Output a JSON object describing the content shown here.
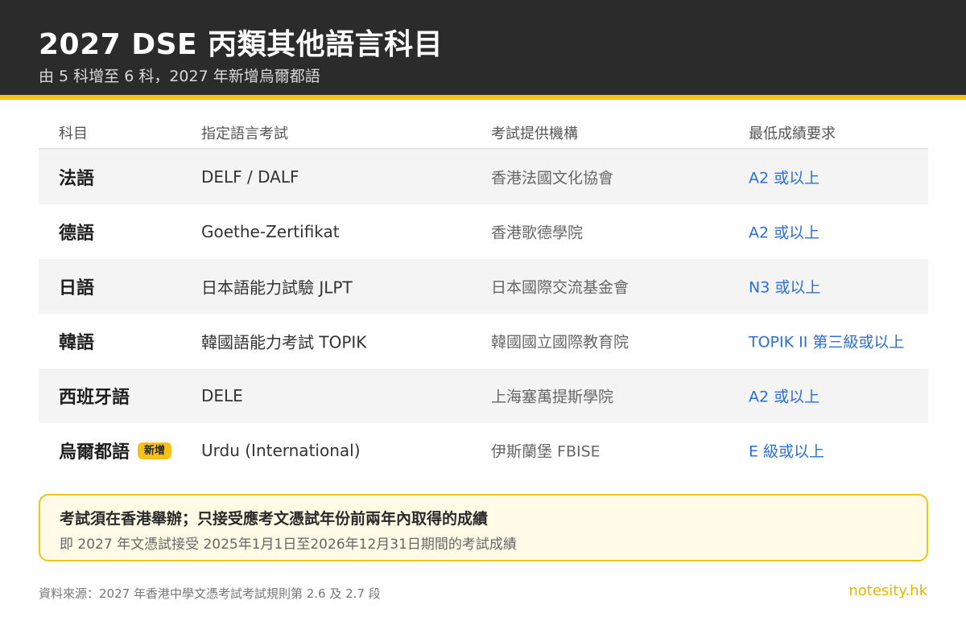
{
  "colors": {
    "header_bg": "#2b2b2b",
    "accent": "#f5c218",
    "requirement_link": "#2b6fd6",
    "note_bg": "#fffbe6",
    "note_border": "#f0c419",
    "brand": "#e8b500"
  },
  "header": {
    "title": "2027 DSE 丙類其他語言科目",
    "subtitle": "由 5 科增至 6 科，2027 年新增烏爾都語"
  },
  "table": {
    "columns": [
      "科目",
      "指定語言考試",
      "考試提供機構",
      "最低成績要求"
    ],
    "rows": [
      {
        "subject": "法語",
        "exam": "DELF / DALF",
        "provider": "香港法國文化協會",
        "requirement": "A2 或以上"
      },
      {
        "subject": "德語",
        "exam": "Goethe-Zertifikat",
        "provider": "香港歌德學院",
        "requirement": "A2 或以上"
      },
      {
        "subject": "日語",
        "exam": "日本語能力試驗 JLPT",
        "provider": "日本國際交流基金會",
        "requirement": "N3 或以上"
      },
      {
        "subject": "韓語",
        "exam": "韓國語能力考試 TOPIK",
        "provider": "韓國國立國際教育院",
        "requirement": "TOPIK II 第三級或以上"
      },
      {
        "subject": "西班牙語",
        "exam": "DELE",
        "provider": "上海塞萬提斯學院",
        "requirement": "A2 或以上"
      },
      {
        "subject": "烏爾都語",
        "badge": "新增",
        "exam": "Urdu (International)",
        "provider": "伊斯蘭堡 FBISE",
        "requirement": "E 級或以上"
      }
    ]
  },
  "note": {
    "title": "考試須在香港舉辦；只接受應考文憑試年份前兩年內取得的成績",
    "body": "即 2027 年文憑試接受 2025年1月1日至2026年12月31日期間的考試成績"
  },
  "footer": {
    "source": "資料來源：2027 年香港中學文憑考試考試規則第 2.6 及 2.7 段",
    "brand": "notesity.hk"
  }
}
